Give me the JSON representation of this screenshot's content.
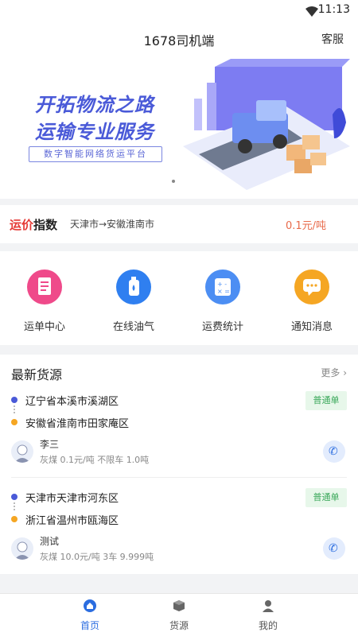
{
  "status_bar": {
    "time": "11:13"
  },
  "header": {
    "title": "1678司机端",
    "service_label": "客服"
  },
  "banner": {
    "headline_1": "开拓物流之路",
    "headline_2": "运输专业服务",
    "subtitle": "数字智能网络货运平台"
  },
  "price_index": {
    "logo_a": "运价",
    "logo_b": "指数",
    "route": "天津市→安徽淮南市",
    "price": "0.1元/吨"
  },
  "quick_actions": [
    {
      "label": "运单中心",
      "icon": "document-icon",
      "color": "#ef4a8a"
    },
    {
      "label": "在线油气",
      "icon": "fuel-icon",
      "color": "#2f7ff0"
    },
    {
      "label": "运费统计",
      "icon": "calculator-icon",
      "color": "#4c8ef3"
    },
    {
      "label": "通知消息",
      "icon": "message-icon",
      "color": "#f5a623"
    }
  ],
  "latest_cargo": {
    "title": "最新货源",
    "more_label": "更多",
    "items": [
      {
        "from": "辽宁省本溪市溪湖区",
        "to": "安徽省淮南市田家庵区",
        "tag": "普通单",
        "contact": "李三",
        "detail": "灰煤 0.1元/吨 不限车 1.0吨"
      },
      {
        "from": "天津市天津市河东区",
        "to": "浙江省温州市瓯海区",
        "tag": "普通单",
        "contact": "测试",
        "detail": "灰煤 10.0元/吨 3车 9.999吨"
      }
    ]
  },
  "tabbar": [
    {
      "label": "首页",
      "icon": "home-icon",
      "active": true
    },
    {
      "label": "货源",
      "icon": "box-icon",
      "active": false
    },
    {
      "label": "我的",
      "icon": "user-icon",
      "active": false
    }
  ],
  "colors": {
    "accent": "#2b6de0",
    "banner_text": "#4a5ad8",
    "price": "#e86a4a",
    "tag_green": "#3aa85a"
  }
}
